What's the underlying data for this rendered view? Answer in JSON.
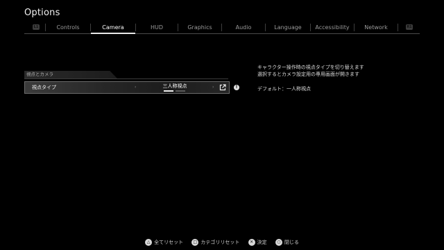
{
  "title": "Options",
  "tabs": [
    {
      "label": "Controls"
    },
    {
      "label": "Camera",
      "active": true
    },
    {
      "label": "HUD"
    },
    {
      "label": "Graphics"
    },
    {
      "label": "Audio"
    },
    {
      "label": "Language"
    },
    {
      "label": "Accessibility"
    },
    {
      "label": "Network"
    }
  ],
  "bumpers": {
    "left": "L1",
    "right": "R1"
  },
  "section": {
    "label": "視点とカメラ"
  },
  "setting": {
    "name": "視点タイプ",
    "value": "三人称視点",
    "option_count": 2,
    "selected_index": 0
  },
  "description": {
    "line1": "キャラクター操作時の視点タイプを切り替えます",
    "line2": "選択するとカメラ設定用の専用画面が開きます",
    "default": "デフォルト：一人称視点"
  },
  "footer": [
    {
      "icon": "triangle-icon",
      "symbol": "△",
      "label": "全てリセット"
    },
    {
      "icon": "square-icon",
      "symbol": "□",
      "label": "カテゴリリセット"
    },
    {
      "icon": "cross-icon",
      "symbol": "✕",
      "label": "決定"
    },
    {
      "icon": "circle-icon",
      "symbol": "○",
      "label": "閉じる"
    }
  ],
  "colors": {
    "background": "#000000",
    "text": "#e8e8e8",
    "accent": "#ffffff"
  }
}
